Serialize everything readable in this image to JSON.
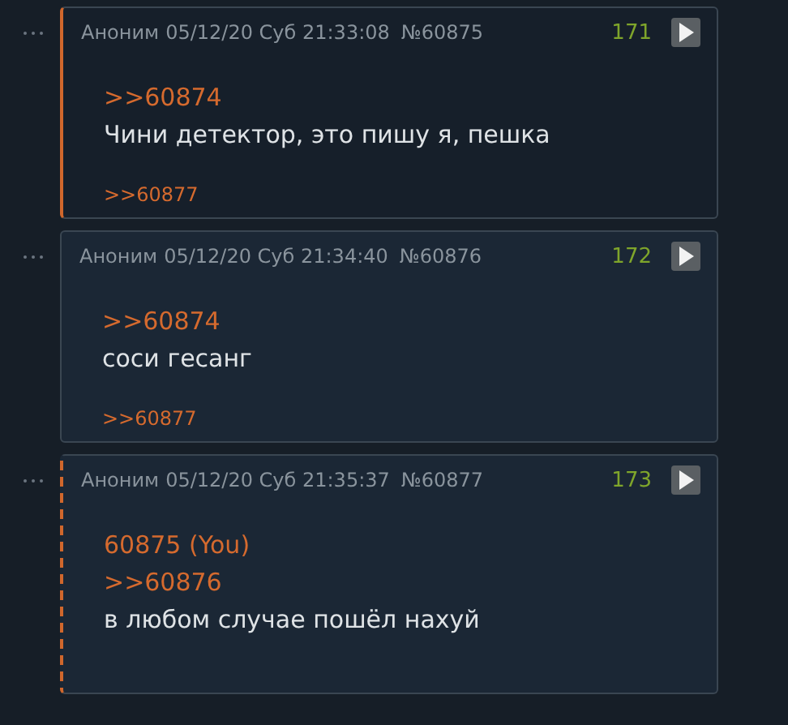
{
  "posts": [
    {
      "replies_to_you": true,
      "own": false,
      "name": "Аноним",
      "date": "05/12/20 Суб 21:33:08",
      "number": "№60875",
      "index": "171",
      "body": [
        {
          "kind": "link",
          "text": ">>60874"
        },
        {
          "kind": "text",
          "text": "Чини детектор, это пишу я, пешка"
        }
      ],
      "replies": [
        ">>60877"
      ]
    },
    {
      "replies_to_you": false,
      "own": false,
      "name": "Аноним",
      "date": "05/12/20 Суб 21:34:40",
      "number": "№60876",
      "index": "172",
      "body": [
        {
          "kind": "link",
          "text": ">>60874"
        },
        {
          "kind": "text",
          "text": "соси гесанг"
        }
      ],
      "replies": [
        ">>60877"
      ]
    },
    {
      "replies_to_you": false,
      "own": true,
      "name": "Аноним",
      "date": "05/12/20 Суб 21:35:37",
      "number": "№60877",
      "index": "173",
      "body": [
        {
          "kind": "link",
          "text": "60875 (You)"
        },
        {
          "kind": "link",
          "text": ">>60876"
        },
        {
          "kind": "text",
          "text": "в любом случае пошёл нахуй"
        }
      ]
    }
  ]
}
